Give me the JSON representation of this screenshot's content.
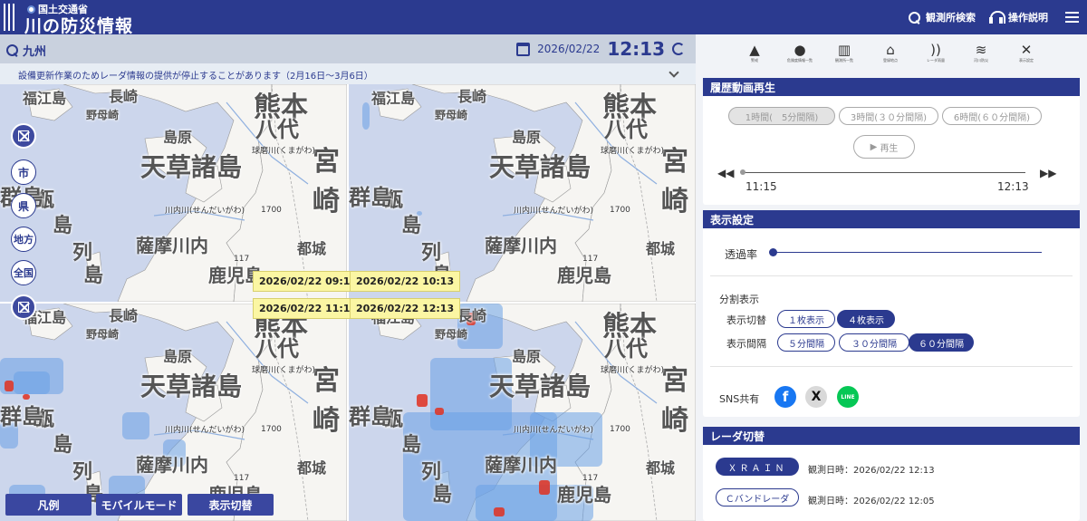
{
  "header": {
    "ministry": "国土交通省",
    "title": "川の防災情報",
    "station_search": "観測所検索",
    "manual": "操作説明"
  },
  "search": {
    "region": "九州",
    "date": "2026/02/22",
    "time": "12:13"
  },
  "notice": {
    "text": "設備更新作業のためレーダ情報の提供が停止することがあります（2月16日～3月6日）"
  },
  "map": {
    "panels": [
      {
        "timestamp": "2026/02/22 09:13"
      },
      {
        "timestamp": "2026/02/22 10:13"
      },
      {
        "timestamp": "2026/02/22 11:13"
      },
      {
        "timestamp": "2026/02/22 12:13"
      }
    ],
    "labels": {
      "kumamoto": "熊本",
      "amakusa": "天草諸島",
      "miyazaki": "宮崎",
      "kagoshima": "鹿児島",
      "satsumasendai": "薩摩川内",
      "nagasaki": "長崎",
      "shimabara": "島原",
      "yatsushiro": "八代",
      "miyakonojo": "都城",
      "fukue": "福江島",
      "nomozaki": "野母崎",
      "koshiki1": "甑",
      "koshiki2": "島",
      "koshiki3": "列",
      "koshiki4": "島",
      "gun": "群島",
      "kumagawa": "球磨川(くまがわ)",
      "sendaigawa": "川内川(せんだいがわ)",
      "elev": "1700",
      "road": "117"
    },
    "controls": {
      "city": "市",
      "pref": "県",
      "region": "地方",
      "country": "全国"
    },
    "bottom_buttons": [
      "凡例",
      "モバイルモード",
      "表示切替"
    ]
  },
  "sidebar": {
    "icons": [
      {
        "icon": "warning-icon",
        "label": "警戒"
      },
      {
        "icon": "alert-circle-icon",
        "label": "危険度情報一覧"
      },
      {
        "icon": "station-list-icon",
        "label": "観測所一覧"
      },
      {
        "icon": "home-icon",
        "label": "登録地点"
      },
      {
        "icon": "radar-icon",
        "label": "レーダ雨量"
      },
      {
        "icon": "waves-icon",
        "label": "河川防災"
      },
      {
        "icon": "wrench-icon",
        "label": "表示設定"
      }
    ],
    "history": {
      "title": "履歴動画再生",
      "opt1": "1時間(　5分間隔)",
      "opt2": "3時間(３０分間隔)",
      "opt3": "6時間(６０分間隔)",
      "play": "再生",
      "start": "11:15",
      "end": "12:13",
      "progress": 0
    },
    "display": {
      "title": "表示設定",
      "opacity_label": "透過率",
      "opacity_value": 0,
      "split_label": "分割表示",
      "switch_label": "表示切替",
      "one": "１枚表示",
      "four": "４枚表示",
      "interval_label": "表示間隔",
      "i5": "５分間隔",
      "i30": "３０分間隔",
      "i60": "６０分間隔",
      "sns_label": "SNS共有",
      "fb": "f",
      "x": "X",
      "line": "LINE"
    },
    "radar": {
      "title": "レーダ切替",
      "xrain": "ＸＲＡＩＮ",
      "xrain_time": "観測日時：2026/02/22 12:13",
      "cband": "Ｃバンドレーダ",
      "cband_time": "観測日時：2026/02/22 12:05"
    }
  },
  "colors": {
    "header": "#2b3a8f",
    "timestamp_bg": "#fbf6a3",
    "sea": "#ccd6ec",
    "land": "#f6f5f2",
    "rain_light": "#6aa0e6",
    "rain_heavy": "#e03020"
  }
}
